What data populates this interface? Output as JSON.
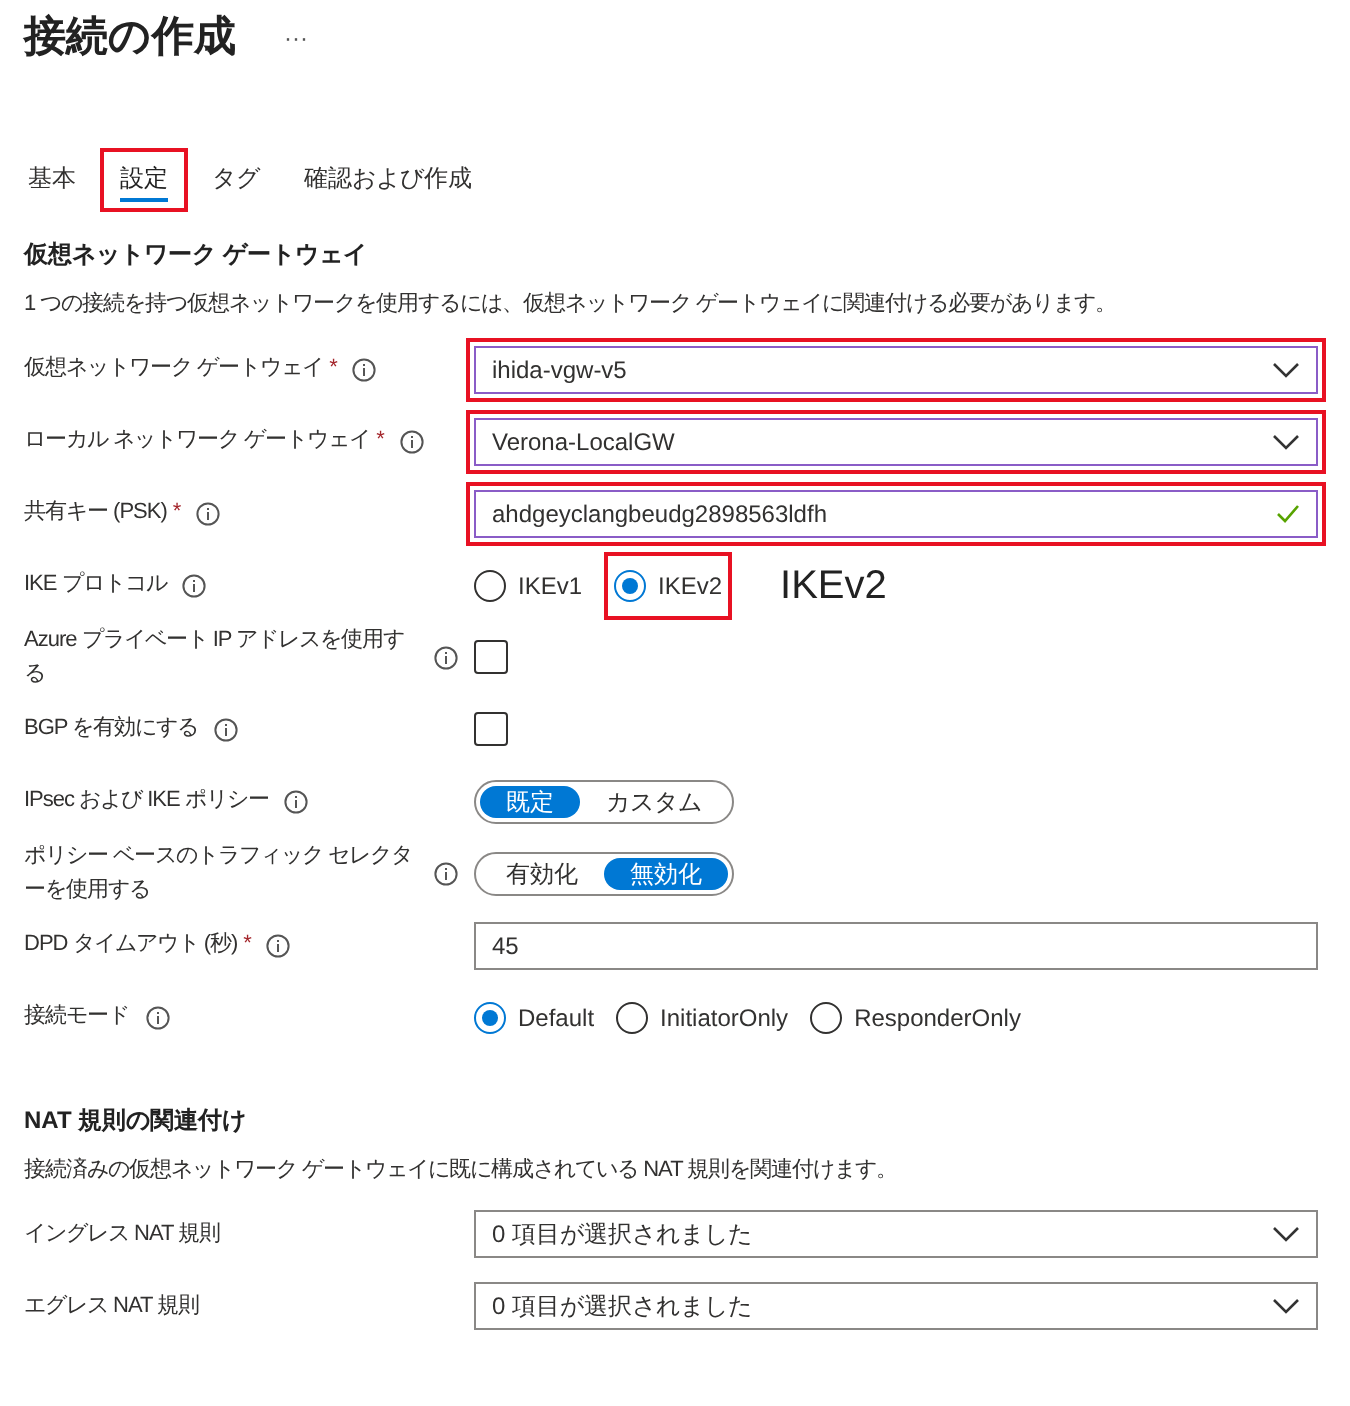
{
  "header": {
    "title": "接続の作成",
    "more": "···"
  },
  "tabs": [
    {
      "label": "基本",
      "selected": false,
      "highlighted": false
    },
    {
      "label": "設定",
      "selected": true,
      "highlighted": true
    },
    {
      "label": "タグ",
      "selected": false,
      "highlighted": false
    },
    {
      "label": "確認および作成",
      "selected": false,
      "highlighted": false
    }
  ],
  "sections": [
    {
      "heading": "仮想ネットワーク ゲートウェイ",
      "description": "1 つの接続を持つ仮想ネットワークを使用するには、仮想ネットワーク ゲートウェイに関連付ける必要があります。",
      "fields": [
        {
          "kind": "select",
          "label": "仮想ネットワーク ゲートウェイ",
          "required_mark": "*",
          "info": true,
          "value": "ihida-vgw-v5",
          "highlighted": true
        },
        {
          "kind": "select",
          "label": "ローカル ネットワーク ゲートウェイ",
          "required_mark": "*",
          "info": true,
          "value": "Verona-LocalGW",
          "highlighted": true
        },
        {
          "kind": "text",
          "label": "共有キー (PSK)",
          "required_mark": "*",
          "info": true,
          "value": "ahdgeyclangbeudg2898563ldfh",
          "valid": true,
          "highlighted": true
        },
        {
          "kind": "radio",
          "label": "IKE プロトコル",
          "info": true,
          "annotation": "IKEv2",
          "options": [
            {
              "label": "IKEv1",
              "selected": false,
              "highlighted": false
            },
            {
              "label": "IKEv2",
              "selected": true,
              "highlighted": true
            }
          ]
        },
        {
          "kind": "checkbox",
          "label": "Azure プライベート IP アドレスを使用する",
          "info": true,
          "checked": false
        },
        {
          "kind": "checkbox",
          "label": "BGP を有効にする",
          "info": true,
          "checked": false
        },
        {
          "kind": "toggle",
          "label": "IPsec および IKE ポリシー",
          "info": true,
          "options": [
            {
              "label": "既定",
              "selected": true
            },
            {
              "label": "カスタム",
              "selected": false
            }
          ]
        },
        {
          "kind": "toggle",
          "label": "ポリシー ベースのトラフィック セレクターを使用する",
          "info": true,
          "options": [
            {
              "label": "有効化",
              "selected": false
            },
            {
              "label": "無効化",
              "selected": true
            }
          ]
        },
        {
          "kind": "text",
          "label": "DPD タイムアウト (秒)",
          "required_mark": "*",
          "info": true,
          "value": "45",
          "valid": false,
          "highlighted": false
        },
        {
          "kind": "radio",
          "label": "接続モード",
          "info": true,
          "options": [
            {
              "label": "Default",
              "selected": true,
              "highlighted": false
            },
            {
              "label": "InitiatorOnly",
              "selected": false,
              "highlighted": false
            },
            {
              "label": "ResponderOnly",
              "selected": false,
              "highlighted": false
            }
          ]
        }
      ]
    },
    {
      "heading": "NAT 規則の関連付け",
      "description": "接続済みの仮想ネットワーク ゲートウェイに既に構成されている NAT 規則を関連付けます。",
      "fields": [
        {
          "kind": "select",
          "label": "イングレス NAT 規則",
          "info": false,
          "value": "0 項目が選択されました",
          "highlighted": false
        },
        {
          "kind": "select",
          "label": "エグレス NAT 規則",
          "info": false,
          "value": "0 項目が選択されました",
          "highlighted": false
        }
      ]
    }
  ]
}
